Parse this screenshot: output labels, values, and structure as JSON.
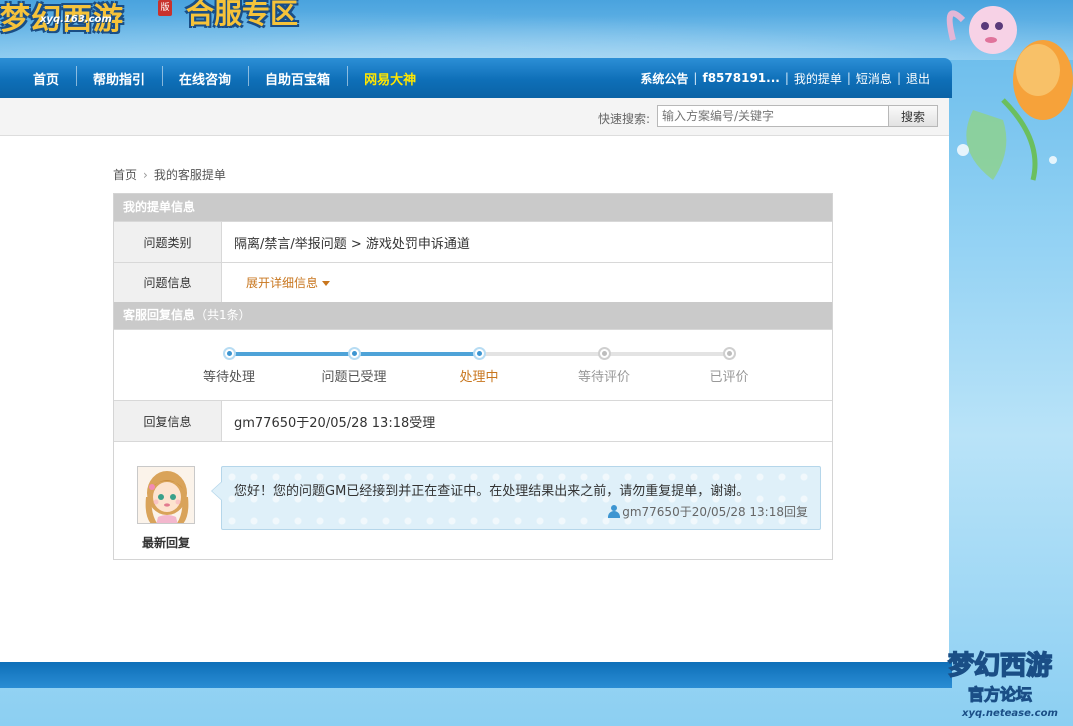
{
  "header": {
    "logo_game": "梦幻西游",
    "logo_badge": "版",
    "logo_site": "xyq.163.com",
    "logo_zone": "合服专区"
  },
  "nav": {
    "items": [
      {
        "label": "首页"
      },
      {
        "label": "帮助指引"
      },
      {
        "label": "在线咨询"
      },
      {
        "label": "自助百宝箱"
      },
      {
        "label": "网易大神",
        "highlight": true
      }
    ],
    "right": {
      "announcement": "系统公告",
      "user": "f8578191...",
      "my_tickets": "我的提单",
      "messages": "短消息",
      "logout": "退出",
      "separator": "|"
    }
  },
  "search": {
    "label": "快速搜索:",
    "placeholder": "输入方案编号/关键字",
    "button": "搜索"
  },
  "breadcrumb": {
    "home": "首页",
    "arrow": "›",
    "current": "我的客服提单"
  },
  "ticket": {
    "section_title": "我的提单信息",
    "category_label": "问题类别",
    "category_value": "隔离/禁言/举报问题 > 游戏处罚申诉通道",
    "info_label": "问题信息",
    "info_expand": "展开详细信息",
    "reply_section_title": "客服回复信息",
    "reply_count": "（共1条）",
    "progress": {
      "current_index": 2,
      "steps": [
        {
          "label": "等待处理",
          "state": "done"
        },
        {
          "label": "问题已受理",
          "state": "done"
        },
        {
          "label": "处理中",
          "state": "current"
        },
        {
          "label": "等待评价",
          "state": "pending"
        },
        {
          "label": "已评价",
          "state": "pending"
        }
      ]
    },
    "reply_label": "回复信息",
    "reply_value": "gm77650于20/05/28 13:18受理"
  },
  "latest_reply": {
    "avatar_label": "最新回复",
    "message": "您好！您的问题GM已经接到并正在查证中。在处理结果出来之前，请勿重复提单，谢谢。",
    "meta": "gm77650于20/05/28 13:18回复"
  },
  "footer_logo": {
    "title": "梦幻西游",
    "subtitle": "官方论坛",
    "url": "xyq.netease.com"
  },
  "colors": {
    "nav_blue": "#0e6fb8",
    "highlight_yellow": "#ffe600",
    "accent_orange": "#c8761e",
    "progress_blue": "#3d95d1"
  }
}
